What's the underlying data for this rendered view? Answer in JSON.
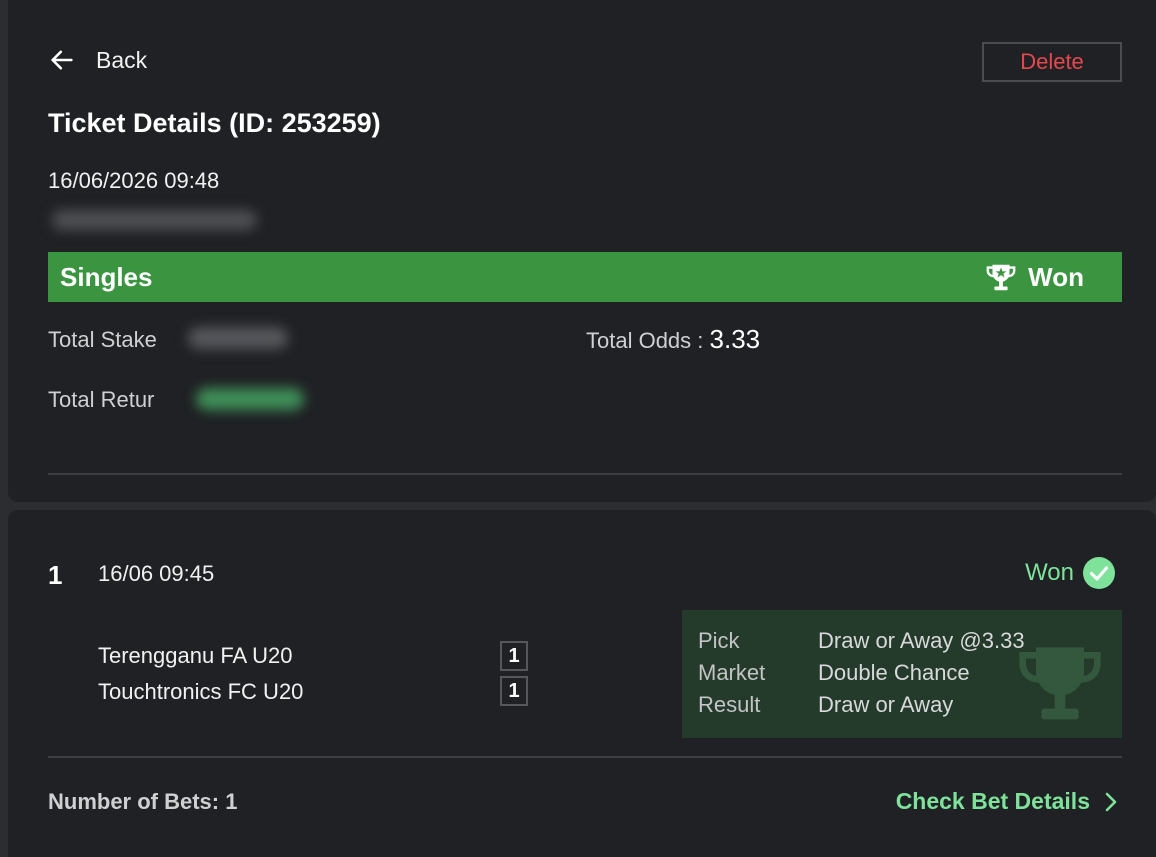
{
  "header": {
    "back_label": "Back",
    "delete_label": "Delete"
  },
  "ticket": {
    "title": "Ticket Details (ID: 253259)",
    "datetime": "16/06/2026 09:48"
  },
  "bet_type": {
    "label": "Singles",
    "status": "Won",
    "color": "#3b9440"
  },
  "summary": {
    "total_stake_label": "Total Stake",
    "total_return_label": "Total Retur",
    "total_odds_label": "Total Odds :",
    "total_odds_value": "3.33"
  },
  "legs": [
    {
      "index": "1",
      "time": "16/06 09:45",
      "status": "Won",
      "home_team": "Terengganu FA U20",
      "home_score": "1",
      "away_team": "Touchtronics FC U20",
      "away_score": "1",
      "pick_label": "Pick",
      "pick_value": "Draw or Away @3.33",
      "market_label": "Market",
      "market_value": "Double Chance",
      "result_label": "Result",
      "result_value": "Draw or Away"
    }
  ],
  "footer": {
    "number_of_bets": "Number of Bets: 1",
    "check_details_label": "Check Bet Details"
  },
  "colors": {
    "won_green": "#7ee29a",
    "delete_red": "#e5484d",
    "card_bg": "#1f2124"
  },
  "icons": [
    "arrow-left-icon",
    "trophy-icon",
    "check-circle-icon",
    "chevron-right-icon"
  ]
}
